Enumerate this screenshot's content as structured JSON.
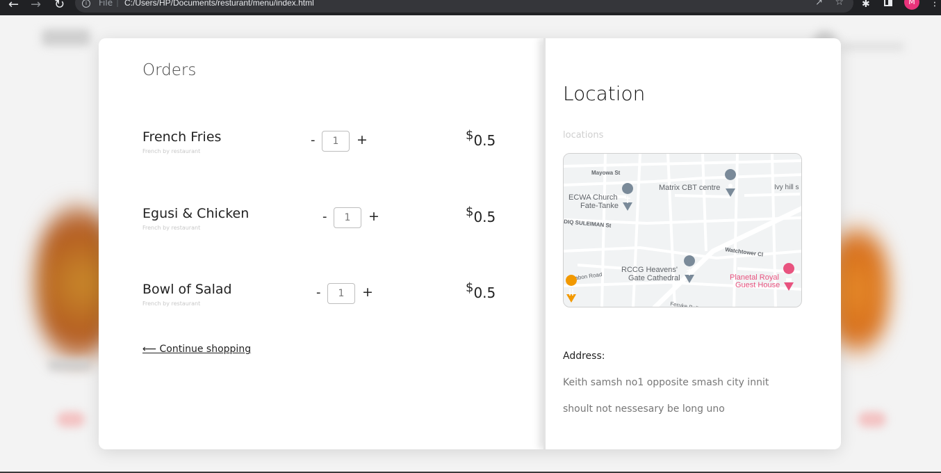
{
  "browser": {
    "scheme_label": "File",
    "url": "C:/Users/HP/Documents/resturant/menu/index.html",
    "profile_initial": "M"
  },
  "orders": {
    "title": "Orders",
    "items": [
      {
        "name": "French Fries",
        "subtitle": "French by restaurant",
        "quantity": "1",
        "currency": "$",
        "price": "0.5"
      },
      {
        "name": "Egusi & Chicken",
        "subtitle": "French by restaurant",
        "quantity": "1",
        "currency": "$",
        "price": "0.5"
      },
      {
        "name": "Bowl of Salad",
        "subtitle": "French by restaurant",
        "quantity": "1",
        "currency": "$",
        "price": "0.5"
      }
    ],
    "minus_label": "-",
    "plus_label": "+",
    "continue_link": "⟵ Continue shopping"
  },
  "location": {
    "title": "Location",
    "select_placeholder": "locations",
    "map_labels": {
      "mayowa": "Mayowa St",
      "matrix": "Matrix CBT centre",
      "ivy": "Ivy hill s",
      "ecwa1": "ECWA Church",
      "ecwa2": "Fate-Tanke",
      "sulaiman": "DIQ SULEIMAN St",
      "watchtower": "Watchtower Cl",
      "rccg1": "RCCG Heavens'",
      "rccg2": "Gate Cathedral",
      "irabon": "Irabon Road",
      "planetal1": "Planetal Royal",
      "planetal2": "Guest House",
      "feruke": "Feruke Bello Road"
    },
    "address_label": "Address:",
    "address_lines": [
      "Keith samsh no1 opposite smash city innit",
      "shoult not nessesary be long uno"
    ]
  },
  "colors": {
    "place_marker": "#7a8a99",
    "hotel_marker": "#e8537f",
    "food_marker": "#f29900"
  }
}
